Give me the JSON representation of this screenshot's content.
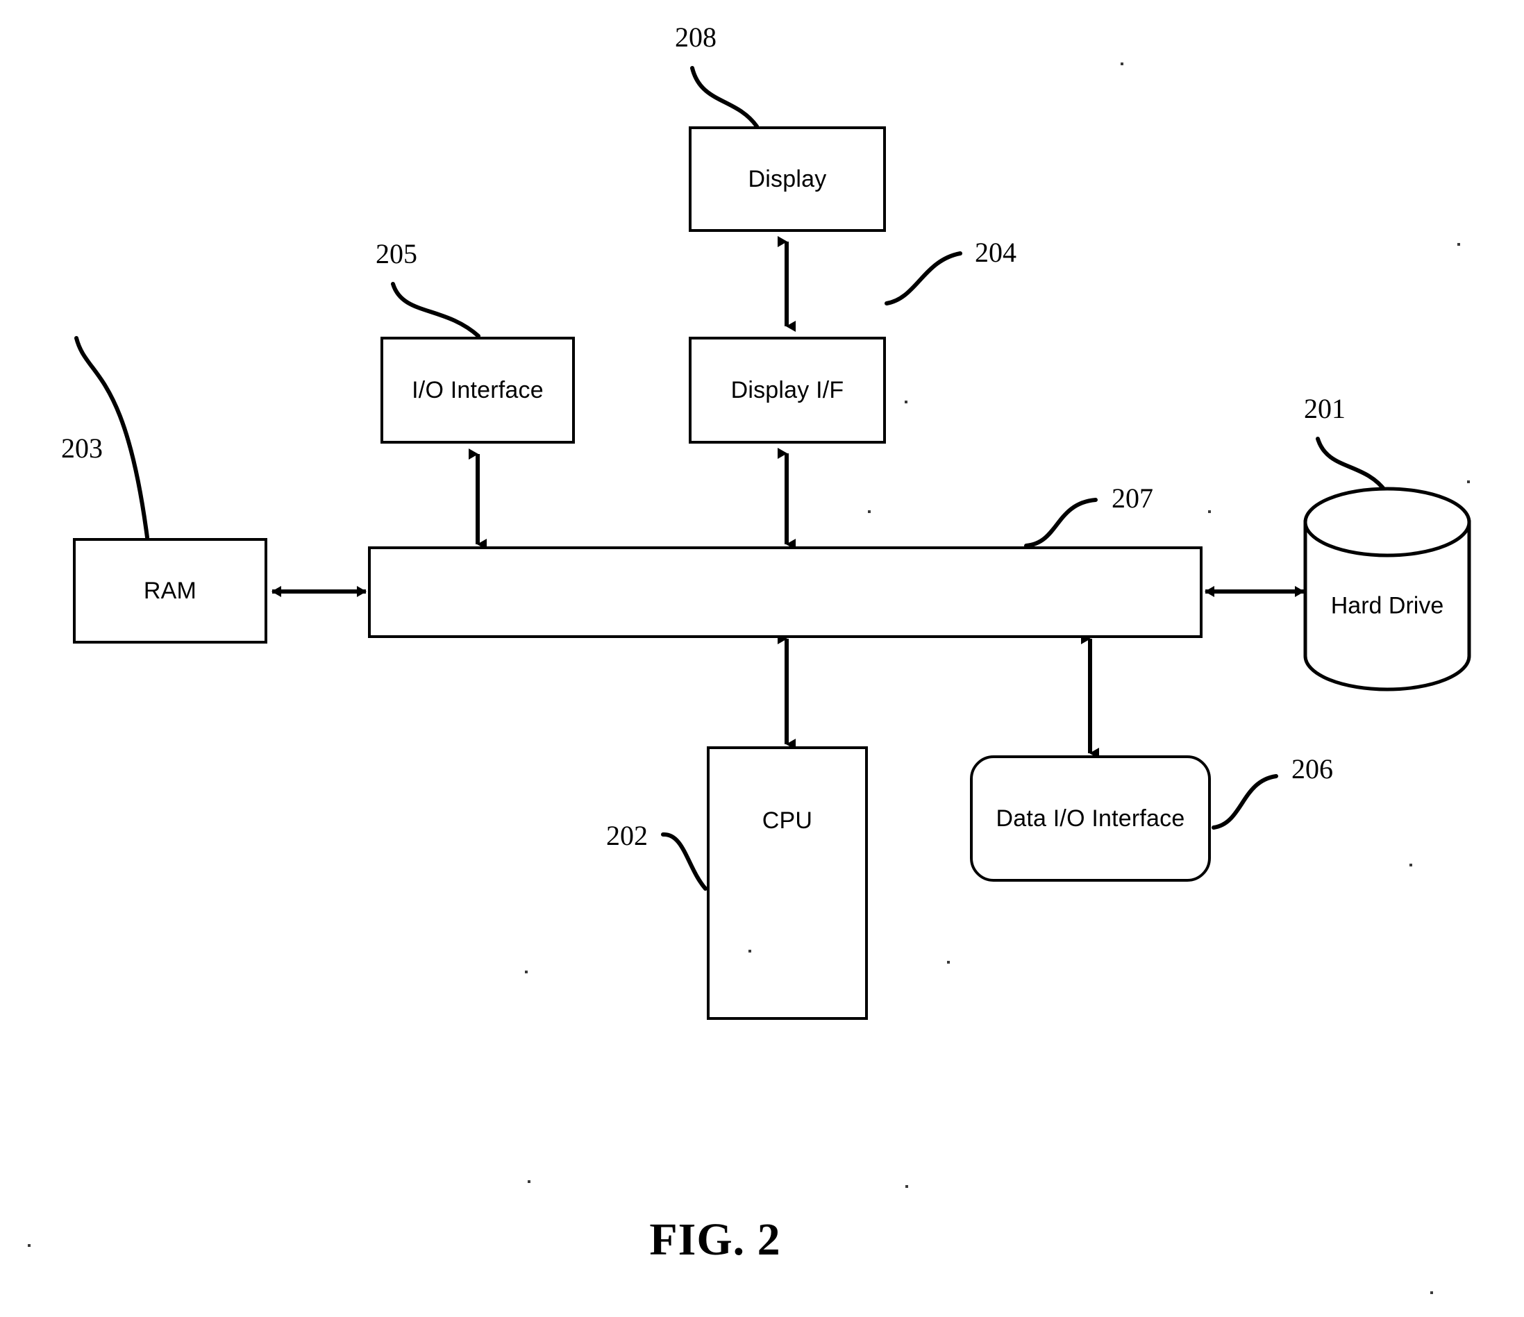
{
  "figure": {
    "caption": "FIG. 2",
    "type": "block-diagram",
    "line_color": "#000000",
    "background": "#ffffff"
  },
  "nodes": {
    "display": {
      "label": "Display",
      "ref": "208",
      "shape": "rectangle"
    },
    "io_interface": {
      "label": "I/O Interface",
      "ref": "205",
      "shape": "rectangle"
    },
    "display_if": {
      "label": "Display I/F",
      "ref": "204",
      "shape": "rectangle"
    },
    "ram": {
      "label": "RAM",
      "ref": "203",
      "shape": "rectangle"
    },
    "bus": {
      "label": "",
      "ref": "207",
      "shape": "bus-bar"
    },
    "hard_drive": {
      "label": "Hard Drive",
      "ref": "201",
      "shape": "cylinder"
    },
    "cpu": {
      "label": "CPU",
      "ref": "202",
      "shape": "rectangle"
    },
    "data_io_interface": {
      "label": "Data I/O Interface",
      "ref": "206",
      "shape": "rounded-rectangle"
    }
  },
  "connections": [
    {
      "from": "display",
      "to": "display_if",
      "arrow": "bidirectional"
    },
    {
      "from": "display_if",
      "to": "bus",
      "arrow": "bidirectional"
    },
    {
      "from": "io_interface",
      "to": "bus",
      "arrow": "bidirectional"
    },
    {
      "from": "ram",
      "to": "bus",
      "arrow": "bidirectional"
    },
    {
      "from": "bus",
      "to": "hard_drive",
      "arrow": "bidirectional"
    },
    {
      "from": "bus",
      "to": "cpu",
      "arrow": "bidirectional"
    },
    {
      "from": "bus",
      "to": "data_io_interface",
      "arrow": "bidirectional"
    }
  ],
  "reference_numerals": {
    "n201": "201",
    "n202": "202",
    "n203": "203",
    "n204": "204",
    "n205": "205",
    "n206": "206",
    "n207": "207",
    "n208": "208"
  }
}
